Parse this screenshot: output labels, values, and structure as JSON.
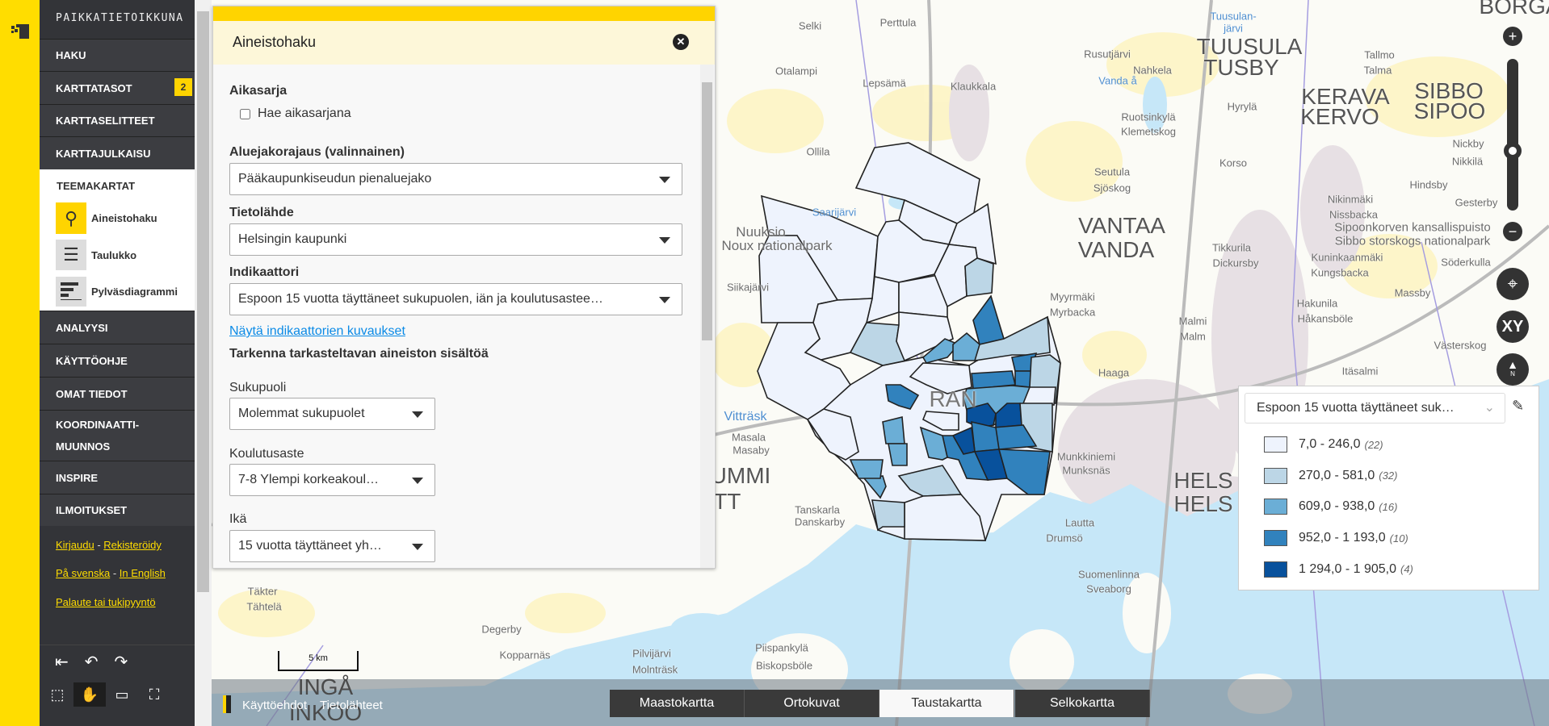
{
  "sidebar": {
    "logo_text": "PAIKKATIETOIKKUNA",
    "items": [
      {
        "label": "HAKU"
      },
      {
        "label": "KARTTATASOT",
        "badge": "2"
      },
      {
        "label": "KARTTASELITTEET"
      },
      {
        "label": "KARTTAJULKAISU"
      }
    ],
    "theme": {
      "title": "TEEMAKARTAT",
      "items": [
        {
          "label": "Aineistohaku",
          "icon": "search-icon"
        },
        {
          "label": "Taulukko",
          "icon": "table-icon"
        },
        {
          "label": "Pylväsdiagrammi",
          "icon": "bar-chart-icon"
        }
      ]
    },
    "items2": [
      {
        "label": "ANALYYSI"
      },
      {
        "label": "KÄYTTÖOHJE"
      },
      {
        "label": "OMAT TIEDOT"
      },
      {
        "label": "KOORDINAATTI-"
      },
      {
        "label": "MUUNNOS"
      },
      {
        "label": "INSPIRE"
      },
      {
        "label": "ILMOITUKSET"
      }
    ],
    "links": {
      "login": "Kirjaudu",
      "sep1": "-",
      "register": "Rekisteröidy",
      "swedish": "På svenska",
      "sep2": "-",
      "english": "In English",
      "feedback": "Palaute tai tukipyyntö"
    },
    "accent": "#ffdd00"
  },
  "panel": {
    "title": "Aineistohaku",
    "timeseries_label": "Aikasarja",
    "timeseries_checkbox": "Hae aikasarjana",
    "timeseries_checked": false,
    "region_label": "Aluejakorajaus (valinnainen)",
    "region_value": "Pääkaupunkiseudun pienaluejako",
    "source_label": "Tietolähde",
    "source_value": "Helsingin kaupunki",
    "indicator_label": "Indikaattori",
    "indicator_value": "Espoon 15 vuotta täyttäneet sukupuolen, iän ja koulutusastee…",
    "desc_link": "Näytä indikaattorien kuvaukset",
    "refine_label": "Tarkenna tarkasteltavan aineiston sisältöä",
    "gender_label": "Sukupuoli",
    "gender_value": "Molemmat sukupuolet",
    "edu_label": "Koulutusaste",
    "edu_value": "7-8 Ylempi korkeakoul…",
    "age_label": "Ikä",
    "age_value": "15 vuotta täyttäneet yh…"
  },
  "legend": {
    "indicator": "Espoon 15 vuotta täyttäneet suk…",
    "classes": [
      {
        "range": "7,0 - 246,0",
        "count": "(22)",
        "color": "#eef3fd"
      },
      {
        "range": "270,0 - 581,0",
        "count": "(32)",
        "color": "#bcd6e6"
      },
      {
        "range": "609,0 - 938,0",
        "count": "(16)",
        "color": "#6baed6"
      },
      {
        "range": "952,0 - 1 193,0",
        "count": "(10)",
        "color": "#3182bd"
      },
      {
        "range": "1 294,0 - 1 905,0",
        "count": "(4)",
        "color": "#08519c"
      }
    ]
  },
  "map": {
    "scale": "5 km",
    "labels": [
      "Selki",
      "Perttula",
      "Otalampi",
      "Lepsämä",
      "Klaukkala",
      "Ollila",
      "Rusutjärvi",
      "Nahkela",
      "Vanda å",
      "Tuusulan-",
      "järvi",
      "TUUSULA",
      "TUSBY",
      "Tallmo",
      "Talma",
      "Hyrylä",
      "KERAVA",
      "KERVO",
      "SIBBO",
      "SIPOO",
      "Ruotsinkylä",
      "Klemetskog",
      "Korso",
      "Nickby",
      "Nikkilä",
      "Seutula",
      "Sjöskog",
      "Hindsby",
      "Nikinmäki",
      "Nissbacka",
      "Gesterby",
      "Saarijärvi",
      "VANTAA",
      "VANDA",
      "Sipoonkorven kansallispuisto",
      "Sibbo storskogs nationalpark",
      "Nuuksio",
      "Noux nationalpark",
      "Tikkurila",
      "Dickursby",
      "Kuninkaanmäki",
      "Kungsbacka",
      "Söderkulla",
      "Siikajärvi",
      "Myyrmäki",
      "Myrbacka",
      "Massby",
      "Hakunila",
      "Håkansböle",
      "Malmi",
      "Malm",
      "Västerskog",
      "Haaga",
      "Itäsalmi",
      "Vitträsk",
      "Masala",
      "Masaby",
      "UMMI",
      "ATT",
      "Tanskarla",
      "Danskarby",
      "Lautta",
      "Drumsö",
      "Munkkiniemi",
      "Munksnäs",
      "HELS",
      "HELS",
      "Suomenlinna",
      "Sveaborg",
      "Täkter",
      "Tähtelä",
      "Degerby",
      "Kopparnäs",
      "Pilvijärvi",
      "Molnträsk",
      "Piispankylä",
      "Biskopsböle",
      "INGÅ",
      "INKOO",
      "BORGÅ",
      "RAN"
    ]
  },
  "controls": {
    "xy": "XY",
    "north": "N"
  },
  "footer": {
    "terms": "Käyttöehdot",
    "sources": "Tietolähteet",
    "basemaps": [
      {
        "label": "Maastokartta",
        "active": false
      },
      {
        "label": "Ortokuvat",
        "active": false
      },
      {
        "label": "Taustakartta",
        "active": true
      },
      {
        "label": "Selkokartta",
        "active": false
      }
    ]
  }
}
